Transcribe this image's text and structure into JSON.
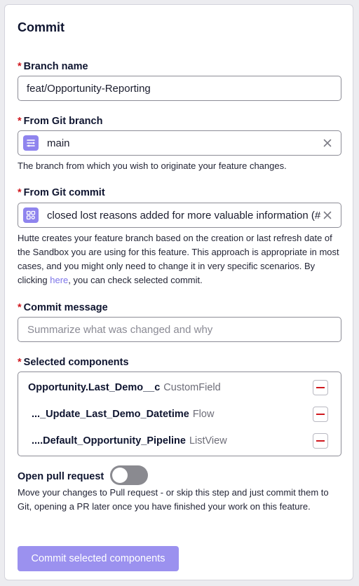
{
  "panel": {
    "title": "Commit"
  },
  "required_marker": "*",
  "branch_name": {
    "label": "Branch name",
    "value": "feat/Opportunity-Reporting"
  },
  "from_git_branch": {
    "label": "From Git branch",
    "value": "main",
    "icon": "git-branch-icon",
    "help": "The branch from which you wish to originate your feature changes."
  },
  "from_git_commit": {
    "label": "From Git commit",
    "value": "closed lost reasons added for more valuable information (#5",
    "icon": "commit-icon",
    "help_before_link": "Hutte creates your feature branch based on the creation or last refresh date of the Sandbox you are using for this feature. This approach is appropriate in most cases, and you might only need to change it in very specific scenarios. By clicking ",
    "help_link": "here",
    "help_after_link": ", you can check selected commit."
  },
  "commit_message": {
    "label": "Commit message",
    "placeholder": "Summarize what was changed and why"
  },
  "selected_components": {
    "label": "Selected components",
    "items": [
      {
        "name": "Opportunity.Last_Demo__c",
        "type": "CustomField"
      },
      {
        "name": "..._Update_Last_Demo_Datetime",
        "type": "Flow"
      },
      {
        "name": "....Default_Opportunity_Pipeline",
        "type": "ListView"
      }
    ]
  },
  "pull_request": {
    "label": "Open pull request",
    "enabled": false,
    "help": "Move your changes to Pull request - or skip this step and just commit them to Git, opening a PR later once you have finished your work on this feature."
  },
  "submit_button": {
    "label": "Commit selected components"
  },
  "colors": {
    "accent": "#9b91ef",
    "required": "#d0191f",
    "link": "#7c74e8",
    "icon_bg": "#8f84ee"
  }
}
